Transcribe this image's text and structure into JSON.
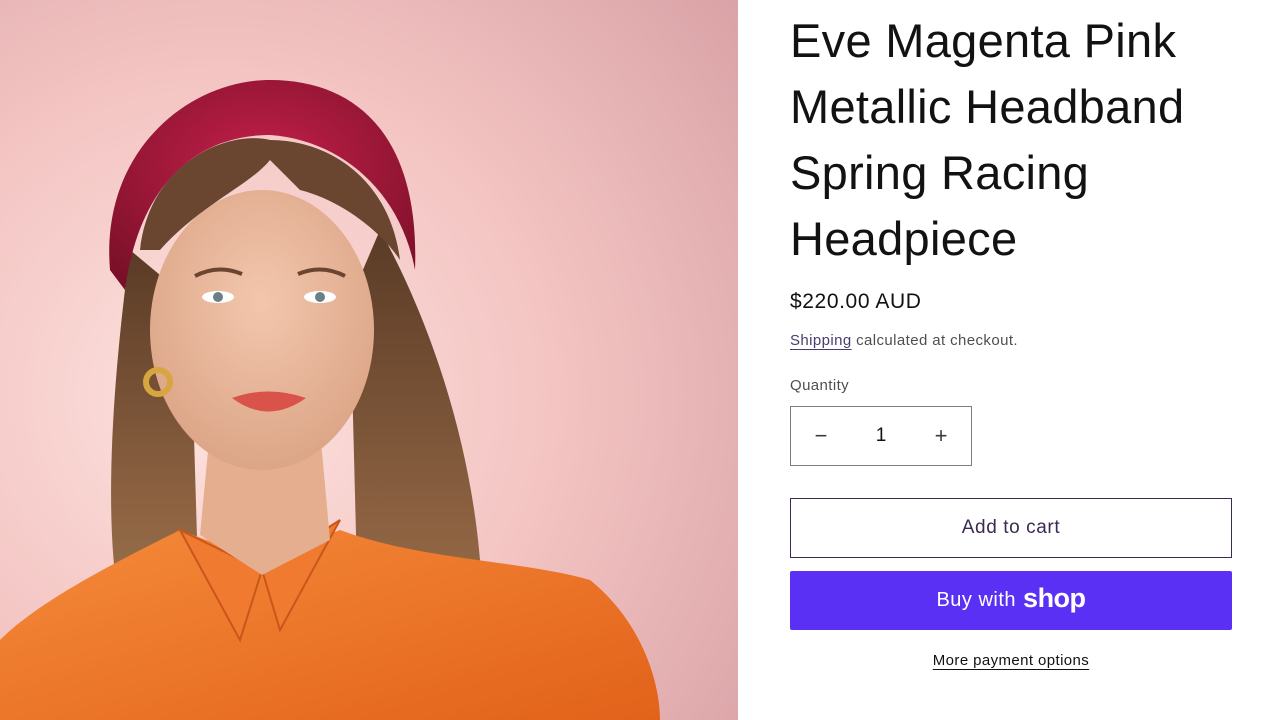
{
  "product": {
    "image_alt": "Model wearing magenta metallic padded headband",
    "title": "Eve Magenta Pink Metallic Headband Spring Racing Headpiece",
    "price": "$220.00 AUD",
    "shipping_link": "Shipping",
    "shipping_rest": " calculated at checkout.",
    "quantity_label": "Quantity",
    "quantity": "1",
    "decrease_symbol": "−",
    "increase_symbol": "+"
  },
  "actions": {
    "add_to_cart": "Add to cart",
    "buy_with": "Buy with",
    "shop_logo": "shop",
    "more_payment": "More payment options"
  },
  "colors": {
    "buy_button": "#5a31f4",
    "add_to_cart_border": "#3b2a52",
    "link": "#4a3d6e"
  }
}
